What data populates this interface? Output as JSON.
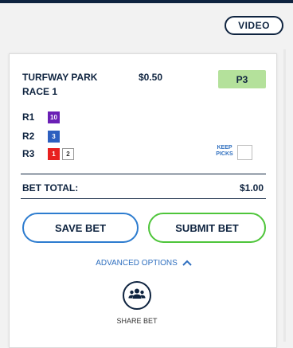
{
  "header": {
    "video_label": "VIDEO"
  },
  "bet": {
    "track_line1": "TURFWAY PARK",
    "track_line2": "RACE 1",
    "amount": "$0.50",
    "type": "P3",
    "races": [
      {
        "label": "R1",
        "picks": [
          {
            "number": "10",
            "color": "#6a1fb5",
            "style": "solid"
          }
        ]
      },
      {
        "label": "R2",
        "picks": [
          {
            "number": "3",
            "color": "#2d5fbf",
            "style": "solid"
          }
        ]
      },
      {
        "label": "R3",
        "picks": [
          {
            "number": "1",
            "color": "#e8201f",
            "style": "solid"
          },
          {
            "number": "2",
            "color": "#ffffff",
            "style": "outline"
          }
        ]
      }
    ],
    "keep_picks_line1": "KEEP",
    "keep_picks_line2": "PICKS",
    "total_label": "BET TOTAL:",
    "total_value": "$1.00"
  },
  "actions": {
    "save_label": "SAVE BET",
    "submit_label": "SUBMIT BET",
    "advanced_label": "ADVANCED OPTIONS",
    "share_label": "SHARE BET"
  },
  "icons": {
    "advanced_toggle": "chevron-up-icon",
    "share": "group-icon"
  },
  "colors": {
    "navy": "#0f2440",
    "bet_type_bg": "#b4e19b",
    "save_border": "#2d7ccf",
    "submit_border": "#4ec53a",
    "link_blue": "#2f6fbf"
  }
}
